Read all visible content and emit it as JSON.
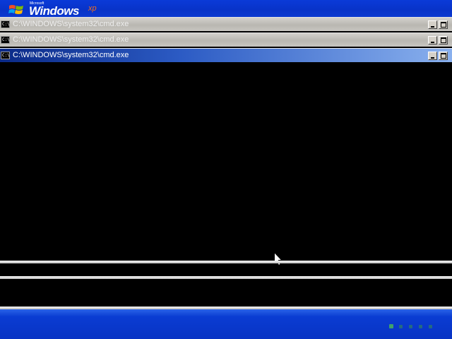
{
  "branding": {
    "microsoft": "Microsoft",
    "windows": "Windows",
    "xp": "xp"
  },
  "windows": [
    {
      "title": "C:\\WINDOWS\\system32\\cmd.exe",
      "icon_text": "C:\\",
      "state": "inactive"
    },
    {
      "title": "C:\\WINDOWS\\system32\\cmd.exe",
      "icon_text": "C:\\",
      "state": "inactive"
    },
    {
      "title": "C:\\WINDOWS\\system32\\cmd.exe",
      "icon_text": "C:\\",
      "state": "active"
    }
  ],
  "progress": {
    "total_dots": 5,
    "lit_dot_index": 0,
    "lit_color": "#3fa16c",
    "dim_color": "#2d7a6a"
  },
  "colors": {
    "setup_blue": "#0833c8",
    "active_title_start": "#0b2a87",
    "active_title_end": "#8ab1ee",
    "xp_orange": "#f36f1c"
  },
  "icons": {
    "window_icon": "cmd-icon",
    "minimize": "minimize-icon",
    "maximize": "maximize-icon",
    "pointer": "mouse-pointer-icon"
  }
}
